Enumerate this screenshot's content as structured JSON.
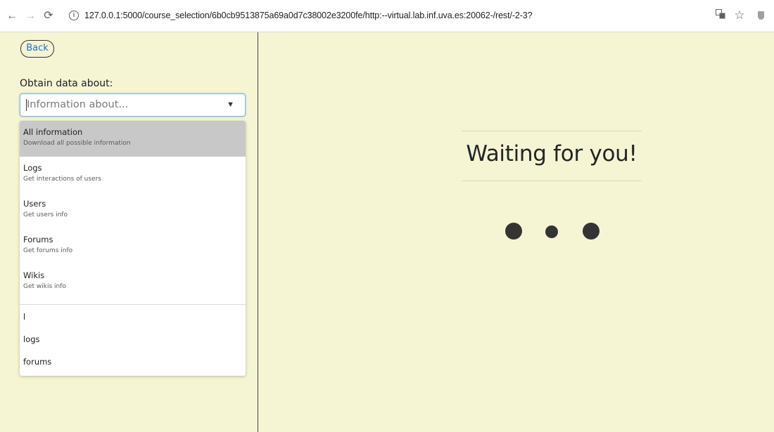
{
  "browser": {
    "url": "127.0.0.1:5000/course_selection/6b0cb9513875a69a0d7c38002e3200fe/http:--virtual.lab.inf.uva.es:20062-/rest/-2-3?"
  },
  "sidebar": {
    "back_label": "Back",
    "obtain_label": "Obtain data about:",
    "select": {
      "placeholder": "Information about...",
      "arrow": "▼"
    },
    "options": [
      {
        "title": "All information",
        "description": "Download all possible information"
      },
      {
        "title": "Logs",
        "description": "Get interactions of users"
      },
      {
        "title": "Users",
        "description": "Get users info"
      },
      {
        "title": "Forums",
        "description": "Get forums info"
      },
      {
        "title": "Wikis",
        "description": "Get wikis info"
      }
    ],
    "extra_options": [
      "l",
      "logs",
      "forums"
    ]
  },
  "main": {
    "title": "Waiting for you!"
  },
  "colors": {
    "page_background": "#f5f5d3",
    "active_option": "#c8c8c8",
    "link_blue": "#1a6fd8"
  },
  "icons": [
    "back-arrow-icon",
    "forward-arrow-icon",
    "reload-icon",
    "info-icon",
    "translate-icon",
    "star-icon",
    "shield-icon",
    "chevron-down-icon"
  ]
}
